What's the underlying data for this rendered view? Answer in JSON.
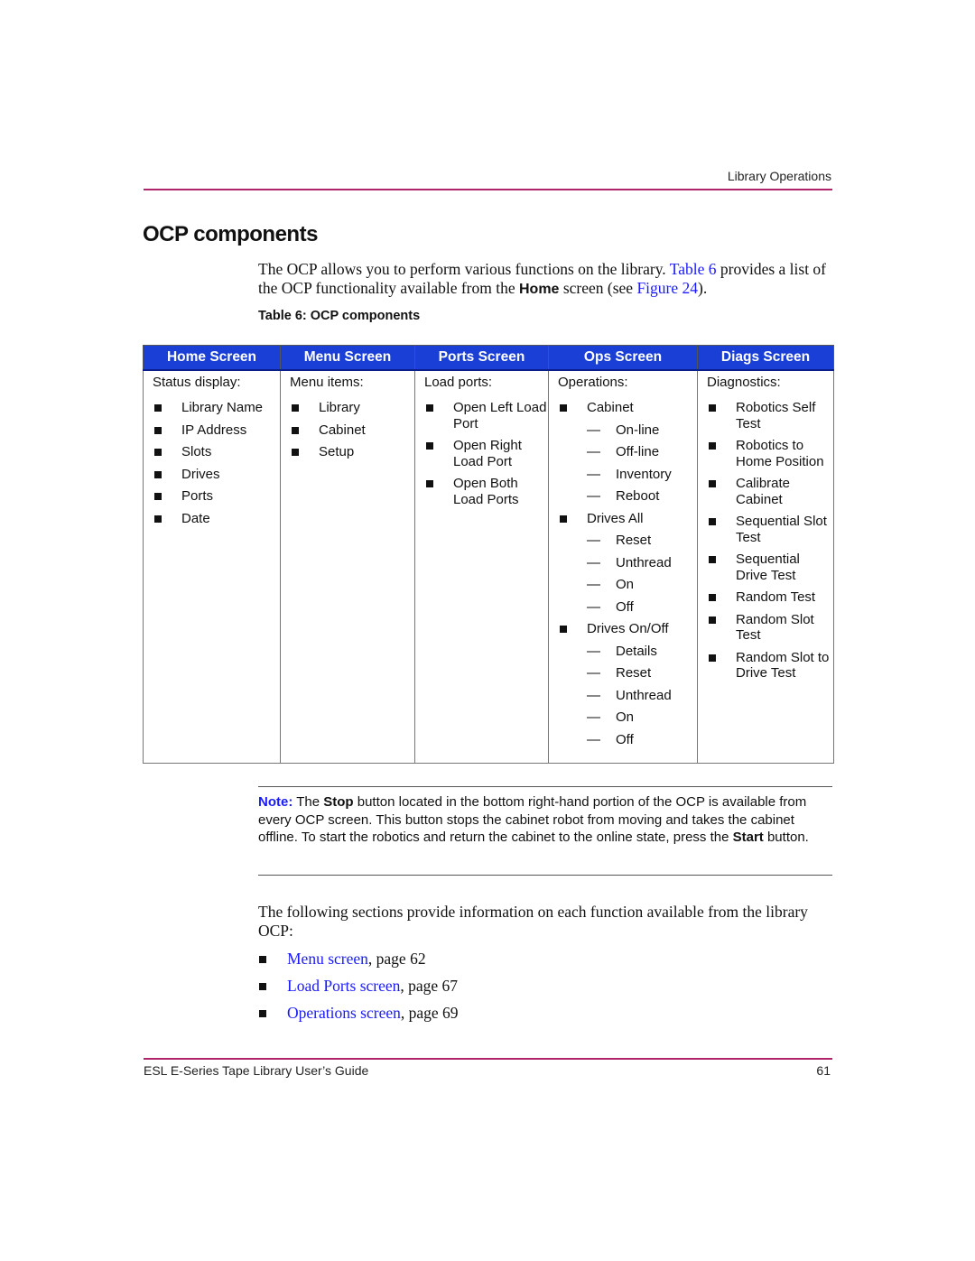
{
  "header": {
    "running_title": "Library Operations"
  },
  "section": {
    "title": "OCP components"
  },
  "intro": {
    "part1": "The OCP allows you to perform various functions on the library. ",
    "link1": "Table 6",
    "part2": " provides a list of the OCP functionality available from the ",
    "bold": "Home",
    "part3": " screen (see ",
    "link2": "Figure 24",
    "part4": ")."
  },
  "table": {
    "caption": "Table 6:  OCP components",
    "header_color": "#1a3fd6",
    "columns": [
      {
        "header": "Home Screen",
        "lead": "Status display:",
        "items": [
          {
            "label": "Library Name",
            "sub": []
          },
          {
            "label": "IP Address",
            "sub": []
          },
          {
            "label": "Slots",
            "sub": []
          },
          {
            "label": "Drives",
            "sub": []
          },
          {
            "label": "Ports",
            "sub": []
          },
          {
            "label": "Date",
            "sub": []
          }
        ]
      },
      {
        "header": "Menu Screen",
        "lead": "Menu items:",
        "items": [
          {
            "label": "Library",
            "sub": []
          },
          {
            "label": "Cabinet",
            "sub": []
          },
          {
            "label": "Setup",
            "sub": []
          }
        ]
      },
      {
        "header": "Ports Screen",
        "lead": "Load ports:",
        "items": [
          {
            "label": "Open Left Load Port",
            "sub": []
          },
          {
            "label": "Open Right Load Port",
            "sub": []
          },
          {
            "label": "Open Both Load Ports",
            "sub": []
          }
        ]
      },
      {
        "header": "Ops Screen",
        "lead": "Operations:",
        "items": [
          {
            "label": "Cabinet",
            "sub": [
              "On-line",
              "Off-line",
              "Inventory",
              "Reboot"
            ]
          },
          {
            "label": "Drives All",
            "sub": [
              "Reset",
              "Unthread",
              "On",
              "Off"
            ]
          },
          {
            "label": "Drives On/Off",
            "sub": [
              "Details",
              "Reset",
              "Unthread",
              "On",
              "Off"
            ]
          }
        ]
      },
      {
        "header": "Diags Screen",
        "lead": "Diagnostics:",
        "items": [
          {
            "label": "Robotics Self Test",
            "sub": []
          },
          {
            "label": "Robotics to Home Position",
            "sub": []
          },
          {
            "label": "Calibrate Cabinet",
            "sub": []
          },
          {
            "label": "Sequential Slot Test",
            "sub": []
          },
          {
            "label": "Sequential Drive Test",
            "sub": []
          },
          {
            "label": "Random Test",
            "sub": []
          },
          {
            "label": "Random Slot Test",
            "sub": []
          },
          {
            "label": "Random Slot to Drive Test",
            "sub": []
          }
        ]
      }
    ]
  },
  "note": {
    "label": "Note:",
    "part1": "  The ",
    "stop": "Stop",
    "part2": " button located in the bottom right-hand portion of the OCP is available from every OCP screen. This button stops the cabinet robot from moving and takes the cabinet offline. To start the robotics and return the cabinet to the online state, press the ",
    "start": "Start",
    "part3": " button."
  },
  "following": {
    "text": "The following sections provide information on each function available from the library OCP:",
    "links": [
      {
        "link": "Menu screen",
        "suffix": ", page 62"
      },
      {
        "link": "Load Ports screen",
        "suffix": ", page 67"
      },
      {
        "link": "Operations screen",
        "suffix": ", page 69"
      }
    ]
  },
  "footer": {
    "title": "ESL E-Series Tape Library User’s Guide",
    "page": "61"
  }
}
